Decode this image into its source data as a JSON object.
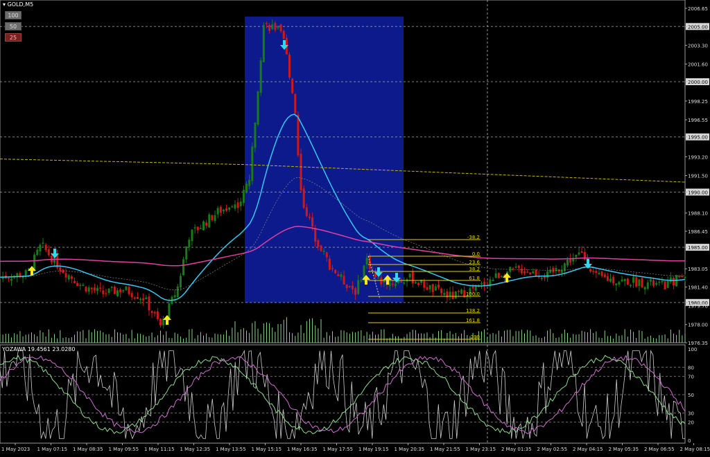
{
  "window": {
    "title_icon": "menu-triangle-icon",
    "symbol_title": "GOLD,M5"
  },
  "timeframe_buttons": [
    {
      "label": "100",
      "active": false
    },
    {
      "label": "50",
      "active": false
    },
    {
      "label": "25",
      "active": true
    }
  ],
  "oscillator": {
    "title": "YOZAWA 19.4561 23.0280",
    "scale_labels": [
      "100",
      "80",
      "70",
      "50",
      "30",
      "20",
      "0"
    ]
  },
  "colors": {
    "background": "#000000",
    "bull_candle": "#1a7a1a",
    "bear_candle": "#d01818",
    "highlight_box": "#0c1a8c",
    "ema_fast": "#38c8f0",
    "ema_slow": "#e040a0",
    "dashed_yellow": "#c8b400",
    "fib_line": "#e8d000",
    "volume": "#8fd48f",
    "arrow_up": "#f8e820",
    "arrow_down": "#30d8f0",
    "grid": "#b8b8b8"
  },
  "chart_data": {
    "type": "candlestick",
    "symbol": "GOLD",
    "timeframe": "M5",
    "ylim": [
      1976.35,
      2006.65
    ],
    "price_axis_labels": [
      "2006.65",
      "2005.00",
      "2003.30",
      "2001.60",
      "2000.00",
      "1998.25",
      "1996.55",
      "1995.00",
      "1993.20",
      "1991.50",
      "1990.00",
      "1988.10",
      "1986.45",
      "1985.00",
      "1983.05",
      "1981.40",
      "1980.00",
      "1979.70",
      "1978.00",
      "1976.35"
    ],
    "boxed_levels": [
      "2005.00",
      "2000.00",
      "1995.00",
      "1990.00",
      "1985.00",
      "1980.00"
    ],
    "time_axis_labels": [
      "1 May 2023",
      "1 May 07:15",
      "1 May 08:35",
      "1 May 09:55",
      "1 May 11:15",
      "1 May 12:35",
      "1 May 13:55",
      "1 May 15:15",
      "1 May 16:35",
      "1 May 17:55",
      "1 May 19:15",
      "1 May 20:35",
      "1 May 21:55",
      "1 May 23:15",
      "2 May 01:35",
      "2 May 02:55",
      "2 May 04:15",
      "2 May 05:35",
      "2 May 06:55",
      "2 May 08:15"
    ],
    "fibonacci_levels": [
      "-38.2",
      "0.0",
      "23.6",
      "38.2",
      "61.8",
      "100.0",
      "138.2",
      "161.8",
      "200"
    ],
    "close_path": [
      [
        0,
        1982.3
      ],
      [
        0.04,
        1982.6
      ],
      [
        0.06,
        1985.2
      ],
      [
        0.09,
        1983.0
      ],
      [
        0.12,
        1981.5
      ],
      [
        0.15,
        1980.8
      ],
      [
        0.18,
        1981.2
      ],
      [
        0.21,
        1980.4
      ],
      [
        0.235,
        1977.8
      ],
      [
        0.26,
        1981.5
      ],
      [
        0.275,
        1986.0
      ],
      [
        0.3,
        1987.3
      ],
      [
        0.32,
        1988.3
      ],
      [
        0.35,
        1989.0
      ],
      [
        0.365,
        1991.5
      ],
      [
        0.375,
        1998.5
      ],
      [
        0.385,
        2005.2
      ],
      [
        0.405,
        2004.8
      ],
      [
        0.415,
        2003.5
      ],
      [
        0.43,
        1998.0
      ],
      [
        0.44,
        1989.5
      ],
      [
        0.46,
        1986.0
      ],
      [
        0.48,
        1983.5
      ],
      [
        0.5,
        1982.0
      ],
      [
        0.52,
        1981.0
      ],
      [
        0.535,
        1984.0
      ],
      [
        0.55,
        1982.0
      ],
      [
        0.57,
        1981.8
      ],
      [
        0.6,
        1982.2
      ],
      [
        0.63,
        1981.2
      ],
      [
        0.66,
        1980.5
      ],
      [
        0.7,
        1981.4
      ],
      [
        0.73,
        1982.6
      ],
      [
        0.76,
        1983.0
      ],
      [
        0.8,
        1982.4
      ],
      [
        0.83,
        1983.8
      ],
      [
        0.85,
        1984.4
      ],
      [
        0.87,
        1982.3
      ],
      [
        0.9,
        1982.0
      ],
      [
        0.94,
        1981.8
      ],
      [
        0.97,
        1981.5
      ],
      [
        1.0,
        1982.6
      ]
    ]
  }
}
